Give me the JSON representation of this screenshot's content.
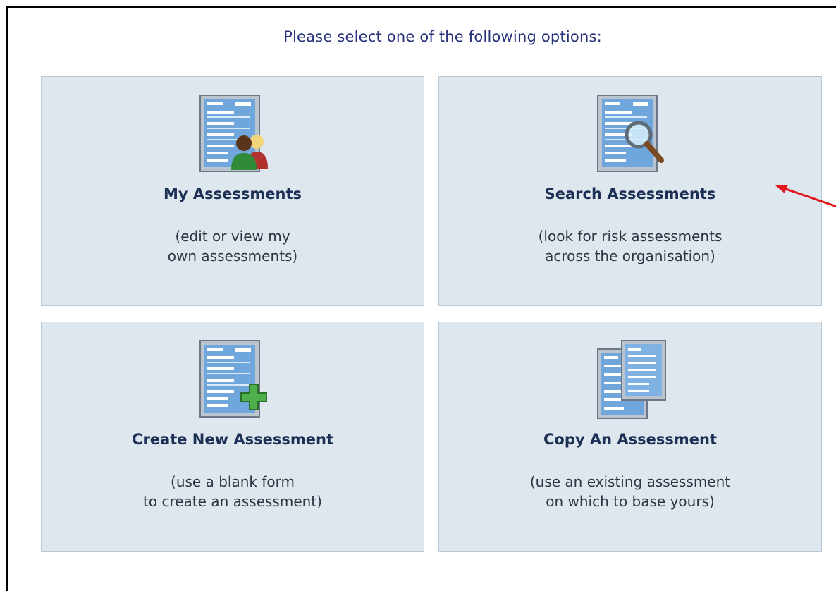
{
  "header": {
    "prompt": "Please select one of the following options:"
  },
  "options": [
    {
      "title": "My Assessments",
      "desc_line1": "(edit or view my",
      "desc_line2": "own assessments)",
      "icon": "assessment-users-icon"
    },
    {
      "title": "Search Assessments",
      "desc_line1": "(look for risk assessments",
      "desc_line2": "across the organisation)",
      "icon": "assessment-search-icon"
    },
    {
      "title": "Create New Assessment",
      "desc_line1": "(use a blank form",
      "desc_line2": "to create an assessment)",
      "icon": "assessment-add-icon"
    },
    {
      "title": "Copy An Assessment",
      "desc_line1": "(use an existing assessment",
      "desc_line2": "on which to base yours)",
      "icon": "assessment-copy-icon"
    }
  ],
  "annotation": {
    "arrow_color": "#e0161b",
    "points_to": "Search Assessments"
  },
  "colors": {
    "tile_background": "#dfe7ee",
    "tile_border": "#b7c9d9",
    "heading_text": "#26327a",
    "title_text": "#1c2f55"
  }
}
